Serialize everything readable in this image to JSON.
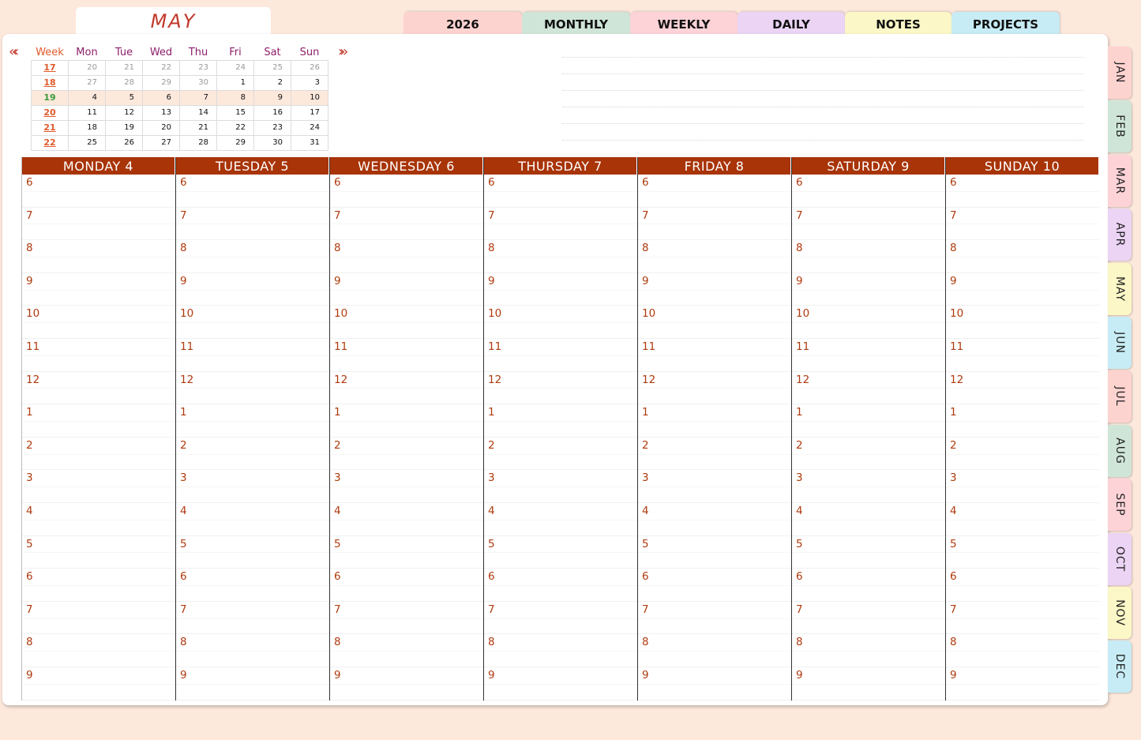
{
  "month_title": "MAY",
  "top_tabs": [
    {
      "label": "2026",
      "color": "#fdd3d0"
    },
    {
      "label": "MONTHLY",
      "color": "#cfe5d8"
    },
    {
      "label": "WEEKLY",
      "color": "#fdd3d8"
    },
    {
      "label": "DAILY",
      "color": "#ecd4f5"
    },
    {
      "label": "NOTES",
      "color": "#fbf7c6"
    },
    {
      "label": "PROJECTS",
      "color": "#c7ecf5"
    }
  ],
  "side_tabs": [
    {
      "label": "JAN",
      "color": "#fdd3d0"
    },
    {
      "label": "FEB",
      "color": "#cfe5d8"
    },
    {
      "label": "MAR",
      "color": "#fdd3d8"
    },
    {
      "label": "APR",
      "color": "#ecd4f5"
    },
    {
      "label": "MAY",
      "color": "#fbf7c6"
    },
    {
      "label": "JUN",
      "color": "#c7ecf5"
    },
    {
      "label": "JUL",
      "color": "#fdd3d0"
    },
    {
      "label": "AUG",
      "color": "#cfe5d8"
    },
    {
      "label": "SEP",
      "color": "#fdd3d8"
    },
    {
      "label": "OCT",
      "color": "#ecd4f5"
    },
    {
      "label": "NOV",
      "color": "#fbf7c6"
    },
    {
      "label": "DEC",
      "color": "#c7ecf5"
    }
  ],
  "mini_calendar": {
    "prev_arrow": "«‹",
    "next_arrow": "›»",
    "headers": [
      "Week",
      "Mon",
      "Tue",
      "Wed",
      "Thu",
      "Fri",
      "Sat",
      "Sun"
    ],
    "current_week": "19",
    "rows": [
      {
        "week": "17",
        "days": [
          "20",
          "21",
          "22",
          "23",
          "24",
          "25",
          "26"
        ],
        "other_month": [
          true,
          true,
          true,
          true,
          true,
          true,
          true
        ]
      },
      {
        "week": "18",
        "days": [
          "27",
          "28",
          "29",
          "30",
          "1",
          "2",
          "3"
        ],
        "other_month": [
          true,
          true,
          true,
          true,
          false,
          false,
          false
        ]
      },
      {
        "week": "19",
        "days": [
          "4",
          "5",
          "6",
          "7",
          "8",
          "9",
          "10"
        ],
        "other_month": [
          false,
          false,
          false,
          false,
          false,
          false,
          false
        ]
      },
      {
        "week": "20",
        "days": [
          "11",
          "12",
          "13",
          "14",
          "15",
          "16",
          "17"
        ],
        "other_month": [
          false,
          false,
          false,
          false,
          false,
          false,
          false
        ]
      },
      {
        "week": "21",
        "days": [
          "18",
          "19",
          "20",
          "21",
          "22",
          "23",
          "24"
        ],
        "other_month": [
          false,
          false,
          false,
          false,
          false,
          false,
          false
        ]
      },
      {
        "week": "22",
        "days": [
          "25",
          "26",
          "27",
          "28",
          "29",
          "30",
          "31"
        ],
        "other_month": [
          false,
          false,
          false,
          false,
          false,
          false,
          false
        ]
      }
    ]
  },
  "days": [
    "MONDAY 4",
    "TUESDAY 5",
    "WEDNESDAY 6",
    "THURSDAY 7",
    "FRIDAY 8",
    "SATURDAY 9",
    "SUNDAY 10"
  ],
  "hours": [
    "6",
    "7",
    "8",
    "9",
    "10",
    "11",
    "12",
    "1",
    "2",
    "3",
    "4",
    "5",
    "6",
    "7",
    "8",
    "9"
  ],
  "colors": {
    "header_bg": "#a83408",
    "hour_text": "#b03a0e",
    "week_link": "#e05a2a",
    "current_week": "#3a9a3a",
    "page_bg": "#fde8dc"
  }
}
